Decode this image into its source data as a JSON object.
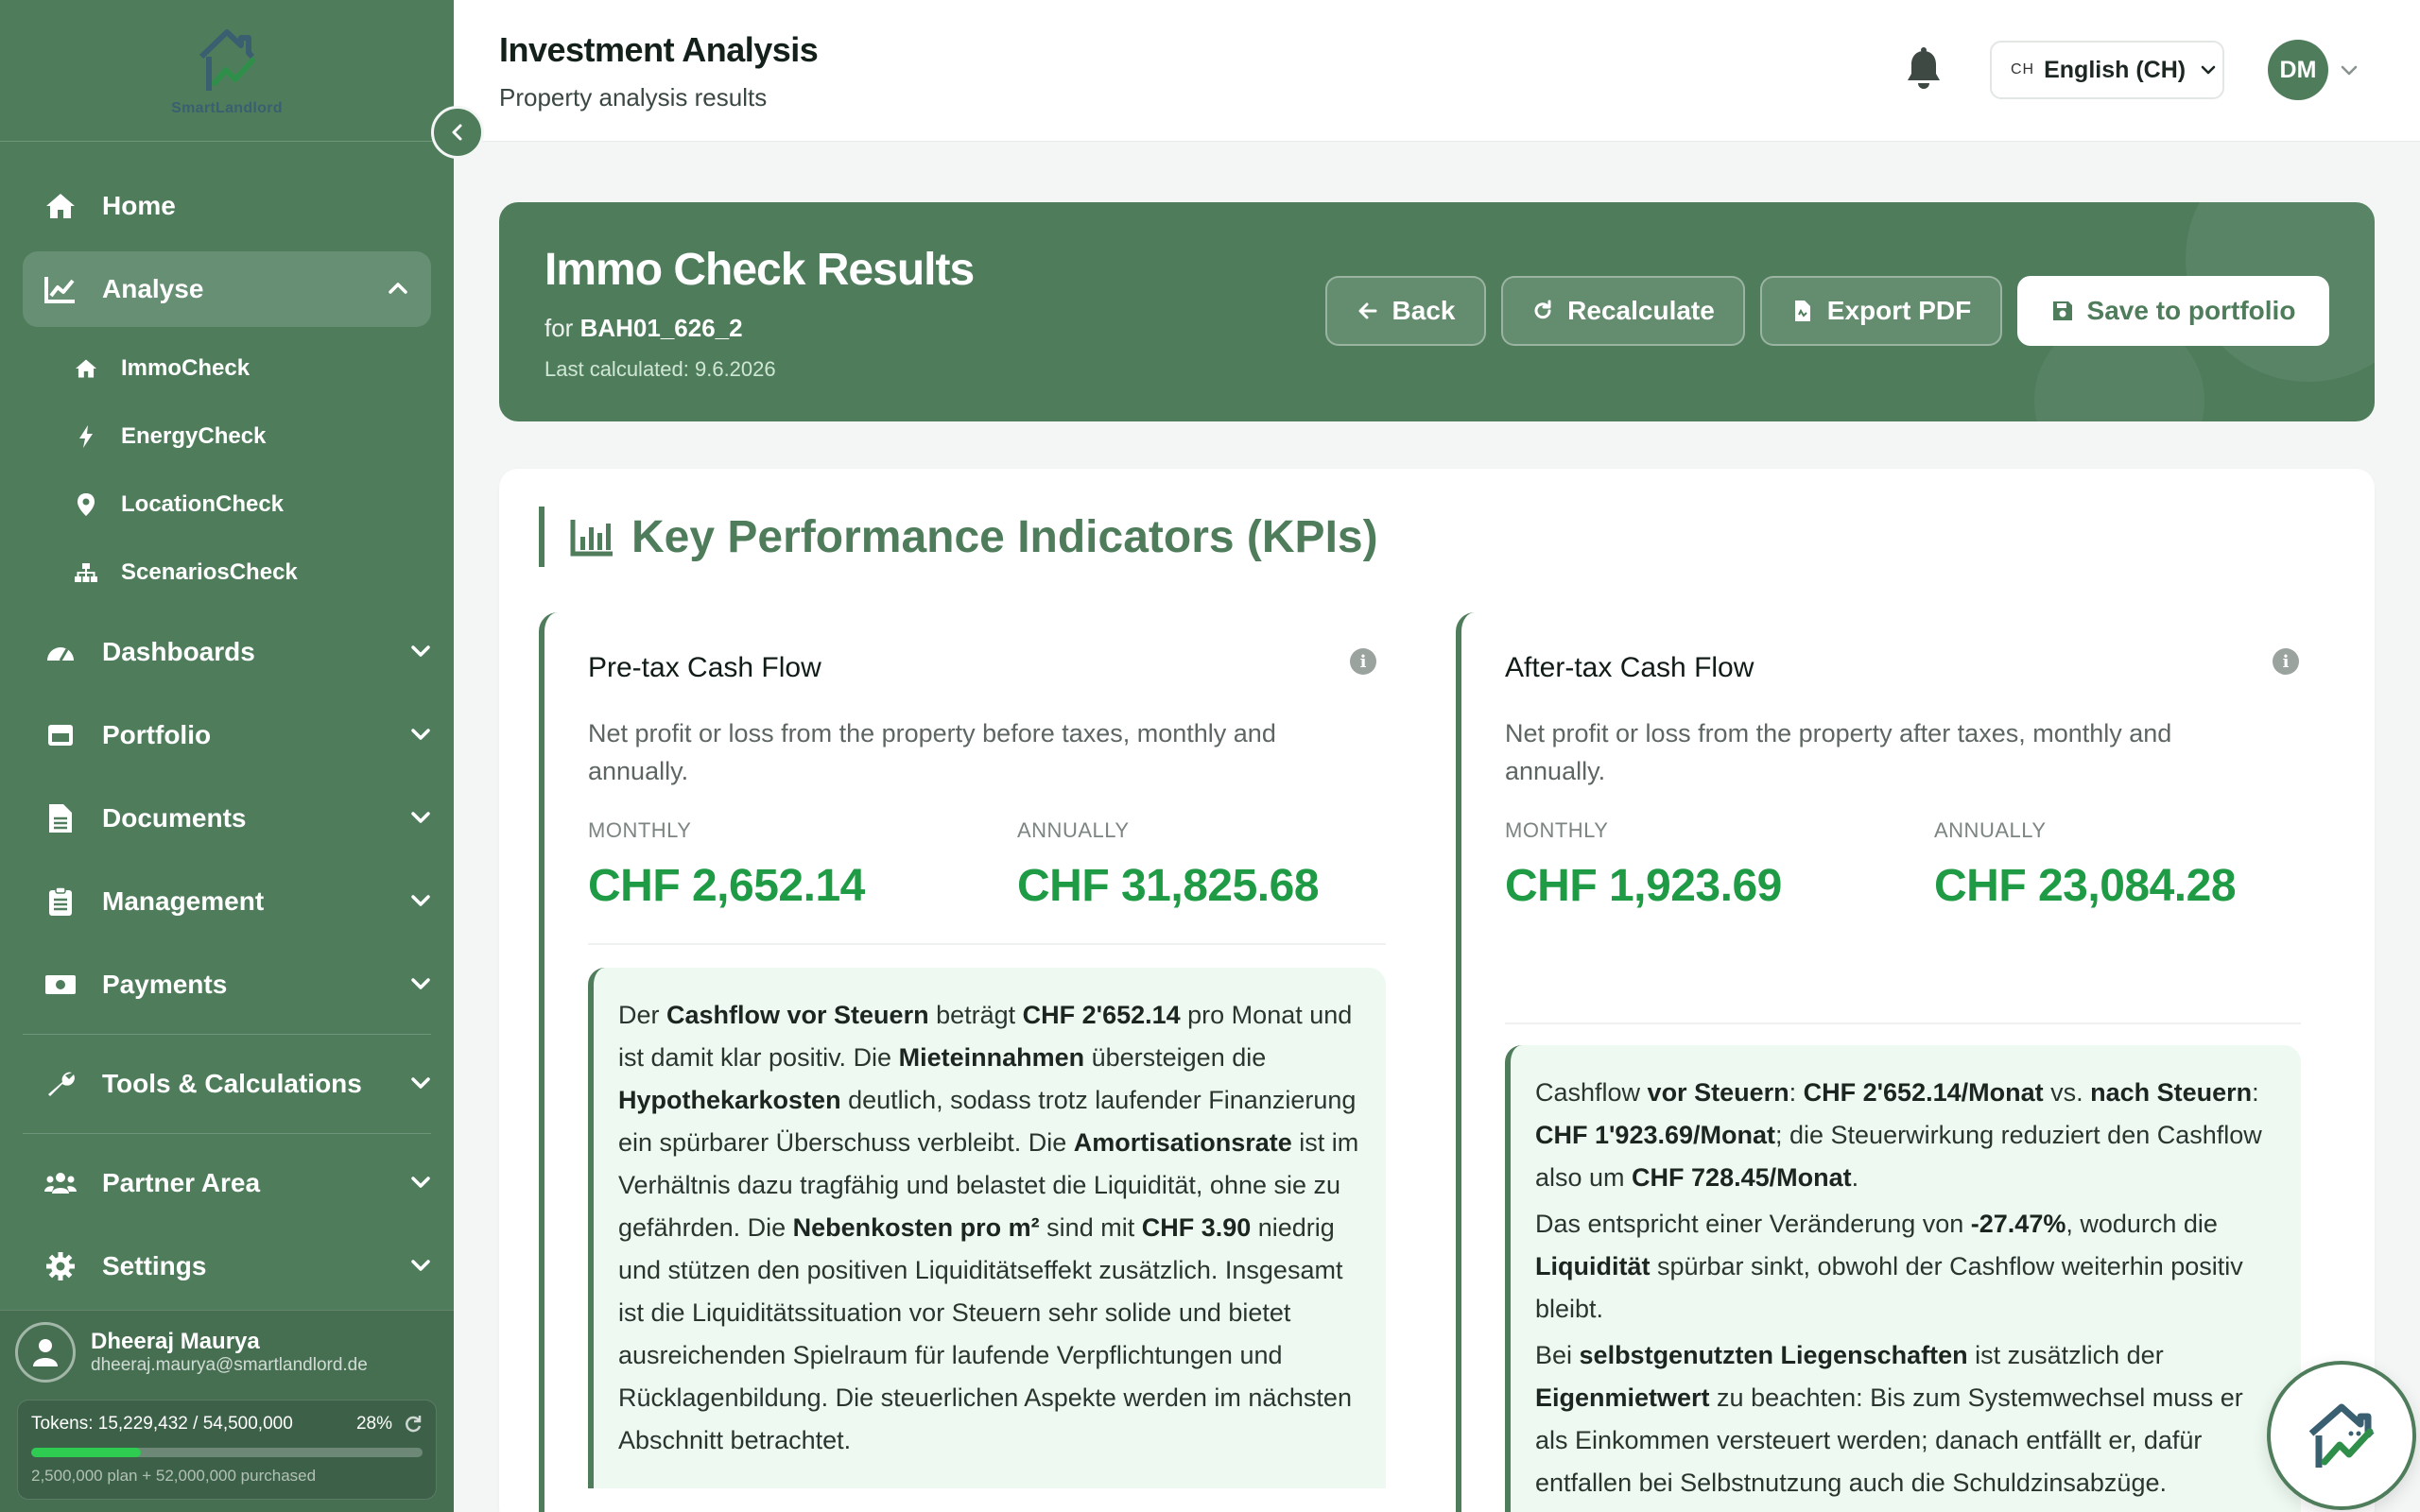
{
  "brand": {
    "logo_text": "SmartLandlord"
  },
  "sidebar": {
    "items": [
      {
        "label": "Home"
      },
      {
        "label": "Analyse"
      },
      {
        "label": "Dashboards"
      },
      {
        "label": "Portfolio"
      },
      {
        "label": "Documents"
      },
      {
        "label": "Management"
      },
      {
        "label": "Payments"
      },
      {
        "label": "Tools & Calculations"
      },
      {
        "label": "Partner Area"
      },
      {
        "label": "Settings"
      }
    ],
    "sub_items": [
      {
        "label": "ImmoCheck"
      },
      {
        "label": "EnergyCheck"
      },
      {
        "label": "LocationCheck"
      },
      {
        "label": "ScenariosCheck"
      }
    ],
    "user": {
      "name": "Dheeraj Maurya",
      "email": "dheeraj.maurya@smartlandlord.de"
    },
    "tokens": {
      "label": "Tokens: 15,229,432 / 54,500,000",
      "percent_label": "28%",
      "percent": 28,
      "sub": "2,500,000 plan + 52,000,000 purchased"
    }
  },
  "header": {
    "title": "Investment Analysis",
    "subtitle": "Property analysis results",
    "lang_flag": "CH",
    "lang": "English (CH)",
    "avatar_initials": "DM"
  },
  "banner": {
    "title": "Immo Check Results",
    "for_prefix": "for",
    "property": "BAH01_626_2",
    "last_calculated": "Last calculated: 9.6.2026",
    "buttons": {
      "back": "Back",
      "recalculate": "Recalculate",
      "export": "Export PDF",
      "save": "Save to portfolio"
    }
  },
  "kpi": {
    "heading": "Key Performance Indicators (KPIs)",
    "cards": [
      {
        "title": "Pre-tax Cash Flow",
        "description": "Net profit or loss from the property before taxes, monthly and annually.",
        "monthly_label": "MONTHLY",
        "monthly_value": "CHF 2,652.14",
        "annual_label": "ANNUALLY",
        "annual_value": "CHF 31,825.68"
      },
      {
        "title": "After-tax Cash Flow",
        "description": "Net profit or loss from the property after taxes, monthly and annually.",
        "monthly_label": "MONTHLY",
        "monthly_value": "CHF 1,923.69",
        "annual_label": "ANNUALLY",
        "annual_value": "CHF 23,084.28"
      }
    ],
    "notes": {
      "pretax": {
        "t1": "Der ",
        "b1": "Cashflow vor Steuern",
        "t2": " beträgt ",
        "b2": "CHF 2'652.14",
        "t3": " pro Monat und ist damit klar positiv. Die ",
        "b3": "Mieteinnahmen",
        "t4": " übersteigen die ",
        "b4": "Hypothekarkosten",
        "t5": " deutlich, sodass trotz laufender Finanzierung ein spürbarer Überschuss verbleibt. Die ",
        "b5": "Amortisationsrate",
        "t6": " ist im Verhältnis dazu tragfähig und belastet die Liquidität, ohne sie zu gefährden. Die ",
        "b6": "Nebenkosten pro m²",
        "t7": " sind mit ",
        "b7": "CHF 3.90",
        "t8": " niedrig und stützen den positiven Liquiditätseffekt zusätzlich. Insgesamt ist die Liquiditätssituation vor Steuern sehr solide und bietet ausreichenden Spielraum für laufende Verpflichtungen und Rücklagenbildung. Die steuerlichen Aspekte werden im nächsten Abschnitt betrachtet."
      },
      "aftertax": {
        "p1_t1": "Cashflow ",
        "p1_b1": "vor Steuern",
        "p1_t2": ": ",
        "p1_b2": "CHF 2'652.14/Monat",
        "p1_t3": " vs. ",
        "p1_b3": "nach Steuern",
        "p1_t4": ": ",
        "p1_b4": "CHF 1'923.69/Monat",
        "p1_t5": "; die Steuerwirkung reduziert den Cashflow also um ",
        "p1_b5": "CHF 728.45/Monat",
        "p1_t6": ".",
        "p2_t1": "Das entspricht einer Veränderung von ",
        "p2_b1": "-27.47%",
        "p2_t2": ", wodurch die ",
        "p2_b2": "Liquidität",
        "p2_t3": " spürbar sinkt, obwohl der Cashflow weiterhin positiv bleibt.",
        "p3_t1": "Bei ",
        "p3_b1": "selbstgenutzten Liegenschaften",
        "p3_t2": " ist zusätzlich der ",
        "p3_b2": "Eigenmietwert",
        "p3_t3": " zu beachten: Bis zum Systemwechsel muss er als Einkommen versteuert werden; danach entfällt er, dafür entfallen bei Selbstnutzung auch die Schuldzinsabzüge."
      }
    }
  },
  "colors": {
    "brand": "#4f7d5c",
    "positive": "#1f9a45",
    "note_bg": "#eefaf1"
  }
}
